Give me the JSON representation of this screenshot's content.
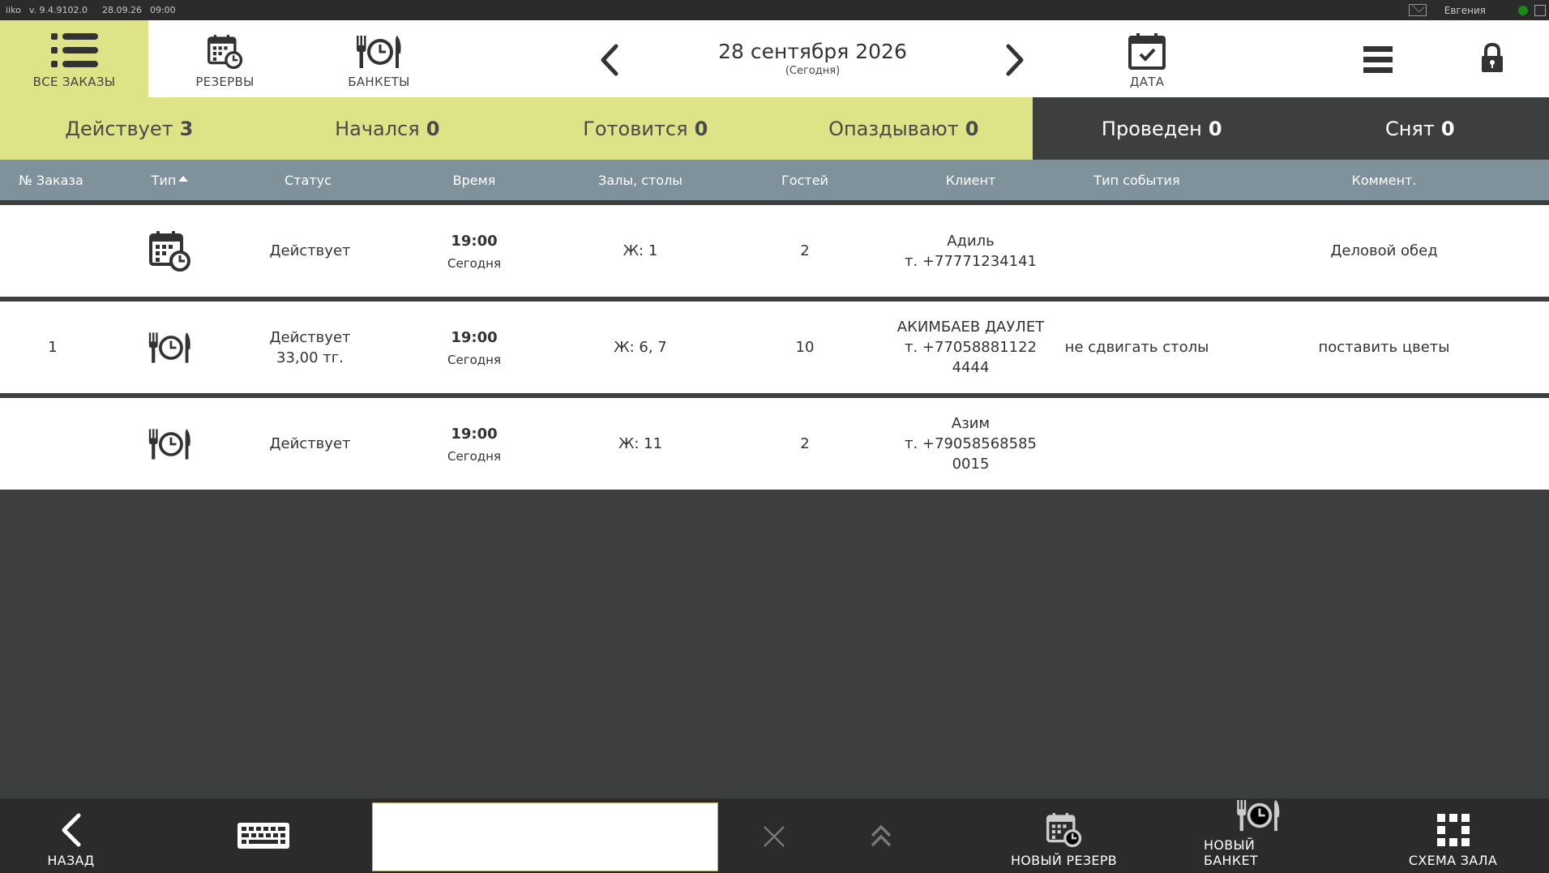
{
  "system_bar": {
    "app_name": "iiko",
    "version": "v. 9.4.9102.0",
    "date": "28.09.26",
    "time": "09:00",
    "user": "Евгения"
  },
  "header": {
    "nav": [
      {
        "label": "ВСЕ ЗАКАЗЫ",
        "icon": "list-icon",
        "active": true
      },
      {
        "label": "РЕЗЕРВЫ",
        "icon": "calendar-clock-icon",
        "active": false
      },
      {
        "label": "БАНКЕТЫ",
        "icon": "fork-clock-knife-icon",
        "active": false
      }
    ],
    "date_main": "28 сентября 2026",
    "date_sub": "(Сегодня)",
    "date_button_label": "ДАТА"
  },
  "tabs": [
    {
      "label": "Действует",
      "count": "3"
    },
    {
      "label": "Начался",
      "count": "0"
    },
    {
      "label": "Готовится",
      "count": "0"
    },
    {
      "label": "Опаздывают",
      "count": "0"
    },
    {
      "label": "Проведен",
      "count": "0"
    },
    {
      "label": "Снят",
      "count": "0"
    }
  ],
  "columns": {
    "order_no": "№ Заказа",
    "type": "Тип",
    "status": "Статус",
    "time": "Время",
    "halls": "Залы, столы",
    "guests": "Гостей",
    "client": "Клиент",
    "event_type": "Тип события",
    "comment": "Коммент."
  },
  "rows": [
    {
      "order_no": "",
      "type_icon": "calendar-clock-icon",
      "status": "Действует",
      "status_amount": "",
      "time": "19:00",
      "day": "Сегодня",
      "halls": "Ж: 1",
      "guests": "2",
      "client_name": "Адиль",
      "client_phone": "т. +77771234141",
      "client_extra": "",
      "event_type": "",
      "comment": "Деловой обед"
    },
    {
      "order_no": "1",
      "type_icon": "fork-clock-knife-icon",
      "status": "Действует",
      "status_amount": "33,00 тг.",
      "time": "19:00",
      "day": "Сегодня",
      "halls": "Ж: 6, 7",
      "guests": "10",
      "client_name": "АКИМБАЕВ ДАУЛЕТ",
      "client_phone": "т. +77058881122",
      "client_extra": "4444",
      "event_type": "не сдвигать столы",
      "comment": "поставить цветы"
    },
    {
      "order_no": "",
      "type_icon": "fork-clock-knife-icon",
      "status": "Действует",
      "status_amount": "",
      "time": "19:00",
      "day": "Сегодня",
      "halls": "Ж: 11",
      "guests": "2",
      "client_name": "Азим",
      "client_phone": "т. +79058568585",
      "client_extra": "0015",
      "event_type": "",
      "comment": ""
    }
  ],
  "bottom": {
    "back_label": "НАЗАД",
    "search_value": "",
    "new_reserve_label": "НОВЫЙ РЕЗЕРВ",
    "new_banquet_label": "НОВЫЙ БАНКЕТ",
    "hall_scheme_label": "СХЕМА ЗАЛА"
  },
  "colors": {
    "accent": "#dde386",
    "dark_bg": "#3d3f3f",
    "header_columns_bg": "#7f929b",
    "bottom_bar": "#2b2b2b"
  }
}
